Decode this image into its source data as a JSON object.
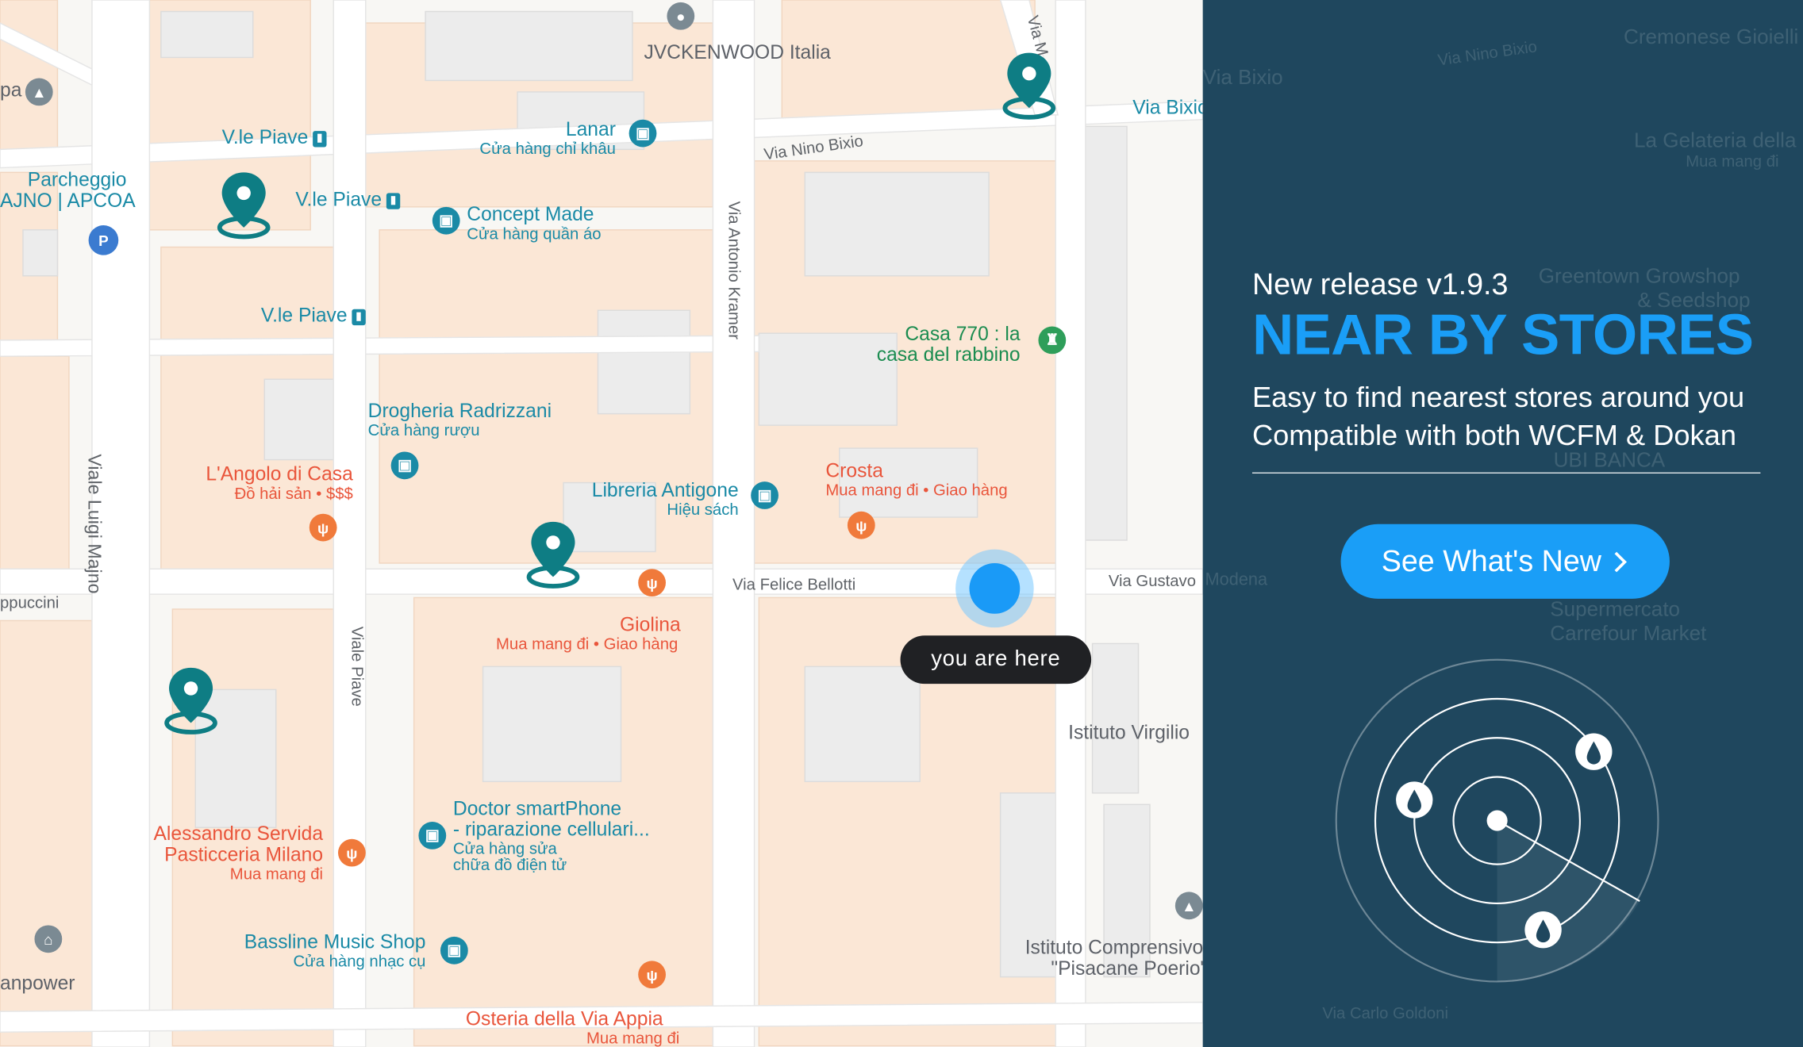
{
  "map": {
    "pois": {
      "jvckenwood": "JVCKENWOOD Italia",
      "lanar": "Lanar",
      "lanar_sub": "Cửa hàng chỉ khâu",
      "concept": "Concept Made",
      "concept_sub": "Cửa hàng quần áo",
      "parcheggio1": "Parcheggio",
      "parcheggio2": "AJNO | APCOA",
      "casa1": "Casa 770 : la",
      "casa2": "casa del rabbino",
      "drogheria": "Drogheria Radrizzani",
      "drogheria_sub": "Cửa hàng rượu",
      "angolo": "L'Angolo di Casa",
      "angolo_sub": "Đồ hải sản • $$$",
      "libreria": "Libreria Antigone",
      "libreria_sub": "Hiệu sách",
      "crosta": "Crosta",
      "crosta_sub": "Mua mang đi • Giao hàng",
      "giolina": "Giolina",
      "giolina_sub": "Mua mang đi • Giao hàng",
      "virgilio": "Istituto Virgilio",
      "doctor1": "Doctor smartPhone",
      "doctor2": "- riparazione cellulari...",
      "doctor_sub1": "Cửa hàng sửa",
      "doctor_sub2": "chữa đồ điện tử",
      "servida1": "Alessandro Servida",
      "servida2": "Pasticceria Milano",
      "servida_sub": "Mua mang đi",
      "bassline": "Bassline Music Shop",
      "bassline_sub": "Cửa hàng nhạc cụ",
      "pisacane1": "Istituto Comprensivo",
      "pisacane2": "\"Pisacane Poerio\"",
      "osteria": "Osteria della Via Appia",
      "osteria_sub": "Mua mang đi",
      "anpower": "anpower",
      "ppuccini": "ppuccini",
      "pa": "pa"
    },
    "transit": {
      "piave_a": "V.le Piave",
      "piave_b": "V.le Piave",
      "piave_c": "V.le Piave",
      "bixio": "Via Bixio"
    },
    "streets": {
      "nino_bixio": "Via Nino Bixio",
      "antonio_kramer": "Via Antonio Kramer",
      "felice_bellotti": "Via Felice Bellotti",
      "gustavo": "Via Gustavo",
      "luigi_majno": "Viale Luigi Majno",
      "viale_piave": "Viale Piave",
      "via_m": "Via M..."
    },
    "you_are_here": "you are here"
  },
  "panel": {
    "release": "New release v1.9.3",
    "headline": "NEAR BY STORES",
    "desc_line1": "Easy to find nearest stores around you",
    "desc_line2": "Compatible with both WCFM & Dokan",
    "cta_label": "See What's New",
    "faint_labels": {
      "cremonese": "Cremonese Gioielli",
      "nino_bixio": "Via Nino Bixio",
      "bixio": "Via Bixio",
      "gelateria": "La Gelateria della",
      "gelateria_sub": "Mua mang đi",
      "greentown1": "Greentown Growshop",
      "greentown2": "& Seedshop",
      "ubi": "UBI BANCA",
      "modena": "Modena",
      "supermercato1": "Supermercato",
      "supermercato2": "Carrefour Market",
      "carlo_goldoni": "Via Carlo Goldoni"
    }
  },
  "colors": {
    "map_bg": "#f8f7f4",
    "block": "#fbe9d9",
    "pin": "#0e7d84",
    "poi_blue": "#1a8aa6",
    "poi_red": "#e9553b",
    "panel_bg": "#1f475e",
    "accent": "#1a9ef7"
  },
  "icons": [
    "map-pin-icon",
    "shopping-bag-icon",
    "fork-knife-icon",
    "parking-icon",
    "castle-icon",
    "graduation-cap-icon",
    "chevron-right-icon",
    "radar-icon",
    "drop-icon"
  ]
}
